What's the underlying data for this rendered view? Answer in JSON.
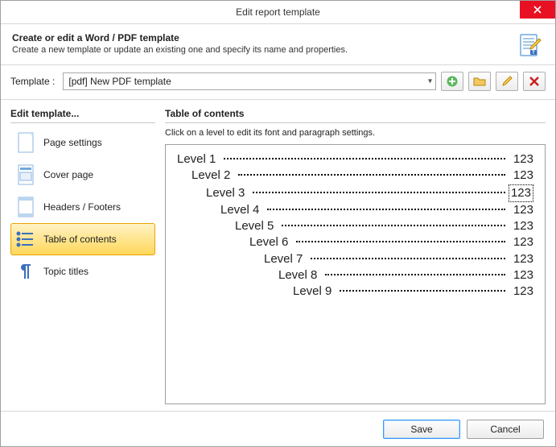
{
  "window": {
    "title": "Edit report template"
  },
  "header": {
    "title": "Create or edit a Word / PDF template",
    "subtitle": "Create a new template or update an existing one and specify its name and properties."
  },
  "template_row": {
    "label": "Template :",
    "value": "[pdf] New PDF template"
  },
  "sidebar": {
    "title": "Edit template...",
    "items": [
      {
        "label": "Page settings"
      },
      {
        "label": "Cover page"
      },
      {
        "label": "Headers / Footers"
      },
      {
        "label": "Table of contents"
      },
      {
        "label": "Topic titles"
      }
    ],
    "selected_index": 3
  },
  "main": {
    "title": "Table of contents",
    "hint": "Click on a level to edit its font and paragraph settings.",
    "page_sample": "123",
    "selected_level": 2,
    "levels": [
      {
        "label": "Level 1",
        "indent": 0
      },
      {
        "label": "Level 2",
        "indent": 1
      },
      {
        "label": "Level 3",
        "indent": 2
      },
      {
        "label": "Level 4",
        "indent": 3
      },
      {
        "label": "Level 5",
        "indent": 4
      },
      {
        "label": "Level 6",
        "indent": 5
      },
      {
        "label": "Level 7",
        "indent": 6
      },
      {
        "label": "Level 8",
        "indent": 7
      },
      {
        "label": "Level 9",
        "indent": 8
      }
    ]
  },
  "footer": {
    "save": "Save",
    "cancel": "Cancel"
  }
}
